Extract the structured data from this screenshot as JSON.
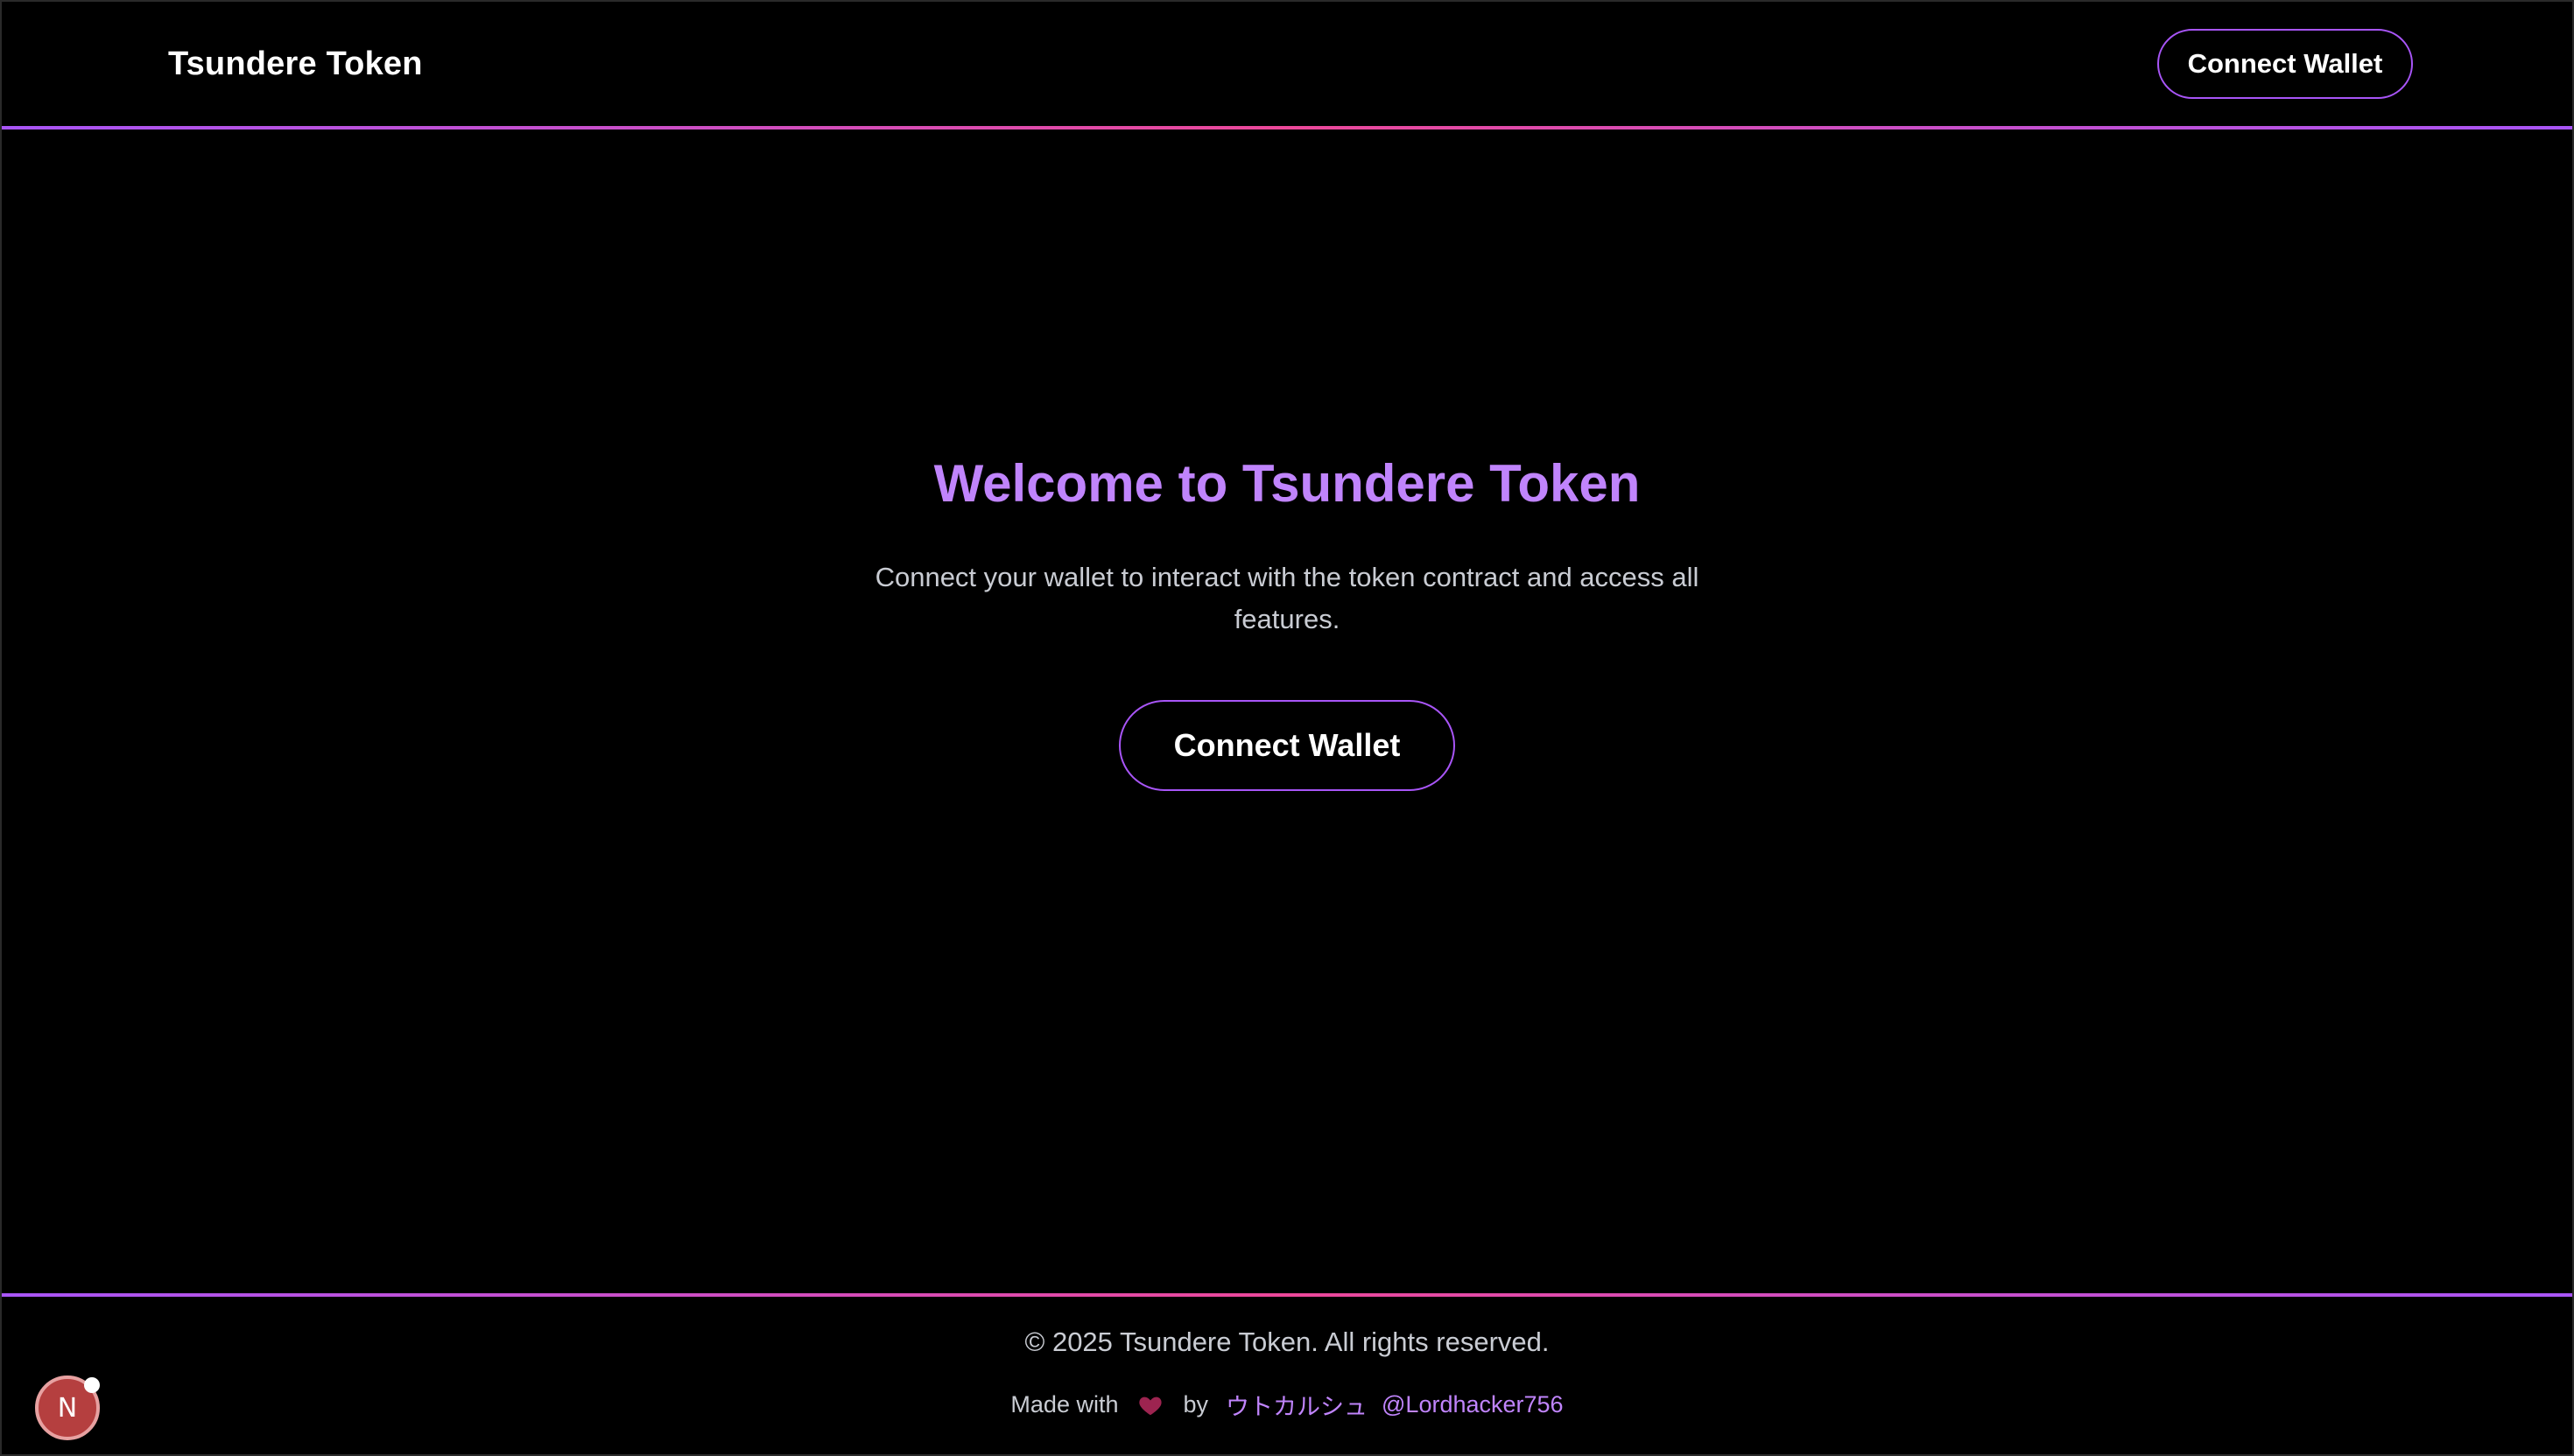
{
  "header": {
    "brand": "Tsundere Token",
    "connect_button": "Connect Wallet"
  },
  "hero": {
    "title": "Welcome to Tsundere Token",
    "description": "Connect your wallet to interact with the token contract and access all features.",
    "connect_button": "Connect Wallet"
  },
  "footer": {
    "copyright": "© 2025 Tsundere Token. All rights reserved.",
    "made_with": "Made with",
    "by": "by",
    "author_jp": "ウトカルシュ",
    "author_handle": "@Lordhacker756",
    "heart_icon": "heart-icon"
  },
  "dev_badge": {
    "label": "N",
    "icon": "nextjs-icon"
  },
  "colors": {
    "background": "#000000",
    "accent_purple": "#a855f7",
    "accent_pink": "#ec4899",
    "title_purple": "#c084fc",
    "heart": "#9d2450",
    "badge": "#b53f3f"
  }
}
